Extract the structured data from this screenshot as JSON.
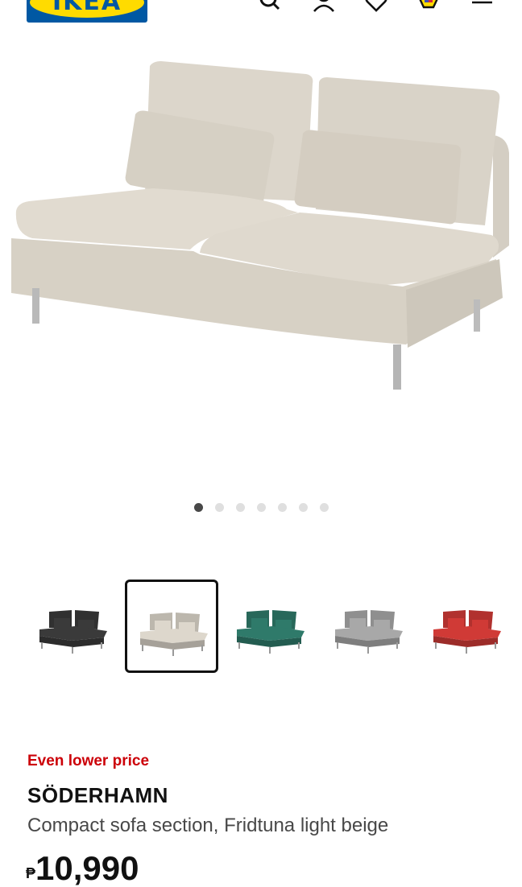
{
  "header": {
    "logo_text": "IKEA",
    "icons": [
      "search-icon",
      "user-icon",
      "heart-icon",
      "cart-icon",
      "menu-icon"
    ]
  },
  "carousel": {
    "image_count": 7,
    "active_index": 0
  },
  "variants": [
    {
      "color": "dark-grey",
      "hex": "#3a3a3a",
      "selected": false
    },
    {
      "color": "light-beige",
      "hex": "#ddd7cc",
      "selected": true
    },
    {
      "color": "dark-green",
      "hex": "#2f7a6a",
      "selected": false
    },
    {
      "color": "grey",
      "hex": "#a8a8a8",
      "selected": false
    },
    {
      "color": "red",
      "hex": "#d03a36",
      "selected": false
    }
  ],
  "product": {
    "promo_label": "Even lower price",
    "name": "SÖDERHAMN",
    "description": "Compact sofa section, Fridtuna light beige",
    "price_currency": "₱",
    "price_value": "10,990"
  },
  "colors": {
    "brand_blue": "#0058a3",
    "brand_yellow": "#ffdb00",
    "promo_red": "#cc0008",
    "sofa_beige": "#ddd7cc"
  }
}
